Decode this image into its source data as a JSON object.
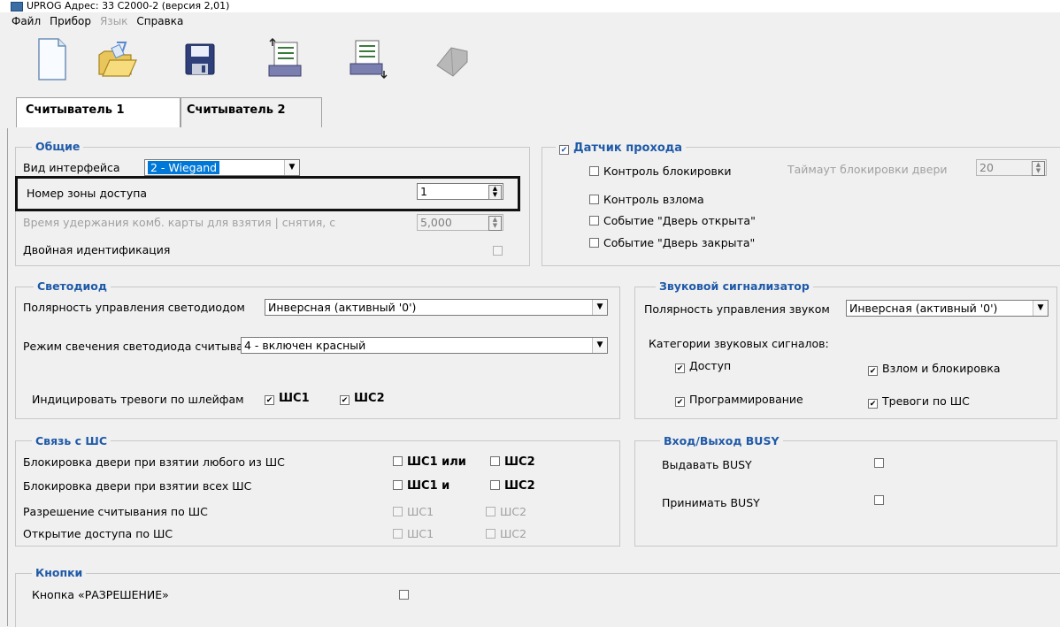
{
  "window": {
    "title": "UPROG Адрес: 33  С2000-2 (версия 2,01)"
  },
  "menu": [
    "Файл",
    "Прибор",
    "Язык",
    "Справка"
  ],
  "toolbar": {
    "icons": [
      "new-file-icon",
      "open-folder-icon",
      "save-disk-icon",
      "read-device-icon",
      "write-device-icon",
      "device-disabled-icon"
    ]
  },
  "tabs": {
    "reader1": "Считыватель 1",
    "reader2": "Считыватель 2"
  },
  "general": {
    "title": "Общие",
    "interface_label": "Вид интерфейса",
    "interface_value": "2 - Wiegand",
    "zone_label": "Номер зоны доступа",
    "zone_value": "1",
    "hold_label": "Время удержания комб. карты для взятия | снятия, с",
    "hold_value": "5,000",
    "double_id_label": "Двойная идентификация"
  },
  "pass_sensor": {
    "title": "Датчик прохода",
    "lock_control": "Контроль блокировки",
    "lock_timeout_label": "Таймаут блокировки двери",
    "lock_timeout_value": "20",
    "break_control": "Контроль взлома",
    "door_open_event": "Событие \"Дверь открыта\"",
    "door_closed_event": "Событие \"Дверь закрыта\""
  },
  "led": {
    "title": "Светодиод",
    "polarity_label": "Полярность управления светодиодом",
    "polarity_value": "Инверсная (активный '0')",
    "mode_label": "Режим свечения светодиода считыват",
    "mode_value": "4 - включен красный",
    "alarm_label": "Индицировать тревоги по шлейфам",
    "sh1": "ШС1",
    "sh2": "ШС2"
  },
  "sound": {
    "title": "Звуковой сигнализатор",
    "polarity_label": "Полярность управления звуком",
    "polarity_value": "Инверсная (активный '0')",
    "categories_label": "Категории звуковых сигналов:",
    "access": "Доступ",
    "break_lock": "Взлом и блокировка",
    "programming": "Программирование",
    "alarms": "Тревоги по ШС"
  },
  "link": {
    "title": "Связь с ШС",
    "lock_any_label": "Блокировка двери при взятии любого из ШС",
    "lock_any_a": "ШС1 или",
    "lock_any_b": "ШС2",
    "lock_all_label": "Блокировка двери при взятии всех ШС",
    "lock_all_a": "ШС1 и",
    "lock_all_b": "ШС2",
    "read_allow_label": "Разрешение считывания по ШС",
    "open_access_label": "Открытие доступа по ШС",
    "sh1": "ШС1",
    "sh2": "ШС2"
  },
  "busy": {
    "title": "Вход/Выход BUSY",
    "out_label": "Выдавать BUSY",
    "in_label": "Принимать BUSY"
  },
  "buttons": {
    "title": "Кнопки",
    "permit_label": "Кнопка «РАЗРЕШЕНИЕ»"
  },
  "colors": {
    "group_title": "#1f5aa8",
    "selection": "#0078d7",
    "highlight_frame": "#111111"
  }
}
